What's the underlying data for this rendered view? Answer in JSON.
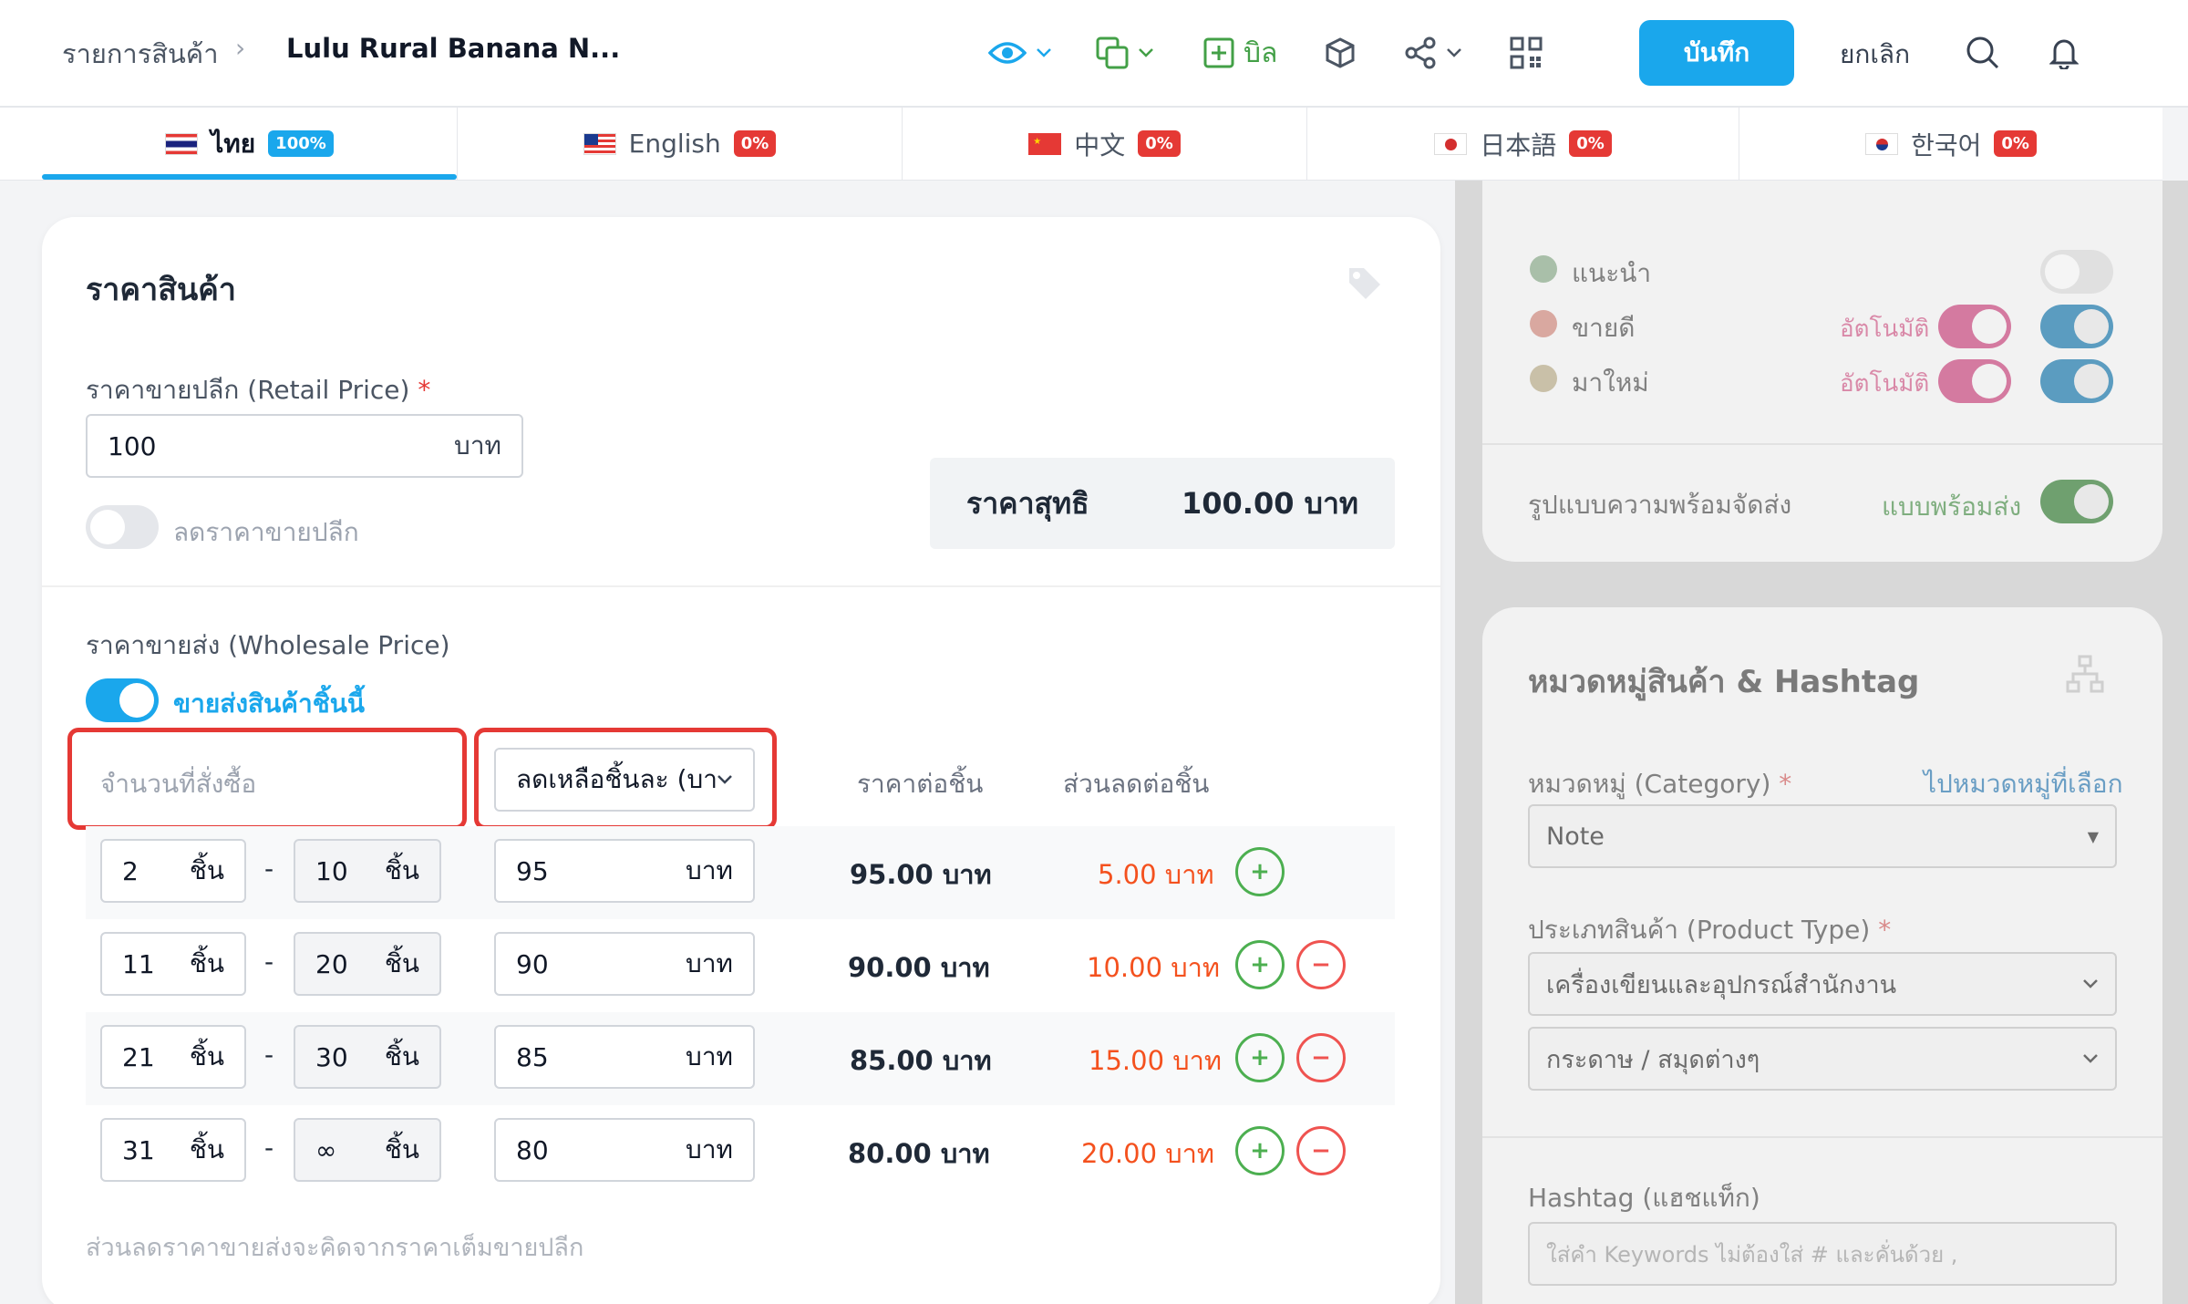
{
  "header": {
    "breadcrumb_parent": "รายการสินค้า",
    "breadcrumb_current": "Lulu Rural Banana N...",
    "bill_label": "บิล",
    "save_label": "บันทึก",
    "cancel_label": "ยกเลิก"
  },
  "languages": [
    {
      "name": "ไทย",
      "percent": "100%",
      "active": true
    },
    {
      "name": "English",
      "percent": "0%"
    },
    {
      "name": "中文",
      "percent": "0%"
    },
    {
      "name": "日本語",
      "percent": "0%"
    },
    {
      "name": "한국어",
      "percent": "0%"
    }
  ],
  "price": {
    "title": "ราคาสินค้า",
    "retail_label": "ราคาขายปลีก (Retail Price)",
    "required_mark": "*",
    "retail_value": "100",
    "unit": "บาท",
    "discount_toggle_label": "ลดราคาขายปลีก",
    "net_label": "ราคาสุทธิ",
    "net_value": "100.00 บาท"
  },
  "wholesale": {
    "label": "ราคาขายส่ง (Wholesale Price)",
    "toggle_label": "ขายส่งสินค้าชิ้นนี้",
    "qty_header": "จำนวนที่สั่งซื้อ",
    "mode_select": "ลดเหลือชิ้นละ (บาท",
    "price_header": "ราคาต่อชิ้น",
    "discount_header": "ส่วนลดต่อชิ้น",
    "piece_unit": "ชิ้น",
    "dash": "-",
    "plus": "+",
    "minus": "−",
    "rows": [
      {
        "from": "2",
        "to": "10",
        "price": "95",
        "per_piece": "95.00 บาท",
        "discount": "5.00 บาท"
      },
      {
        "from": "11",
        "to": "20",
        "price": "90",
        "per_piece": "90.00 บาท",
        "discount": "10.00 บาท"
      },
      {
        "from": "21",
        "to": "30",
        "price": "85",
        "per_piece": "85.00 บาท",
        "discount": "15.00 บาท"
      },
      {
        "from": "31",
        "to": "∞",
        "price": "80",
        "per_piece": "80.00 บาท",
        "discount": "20.00 บาท"
      }
    ],
    "note": "ส่วนลดราคาขายส่งจะคิดจากราคาเต็มขายปลีก"
  },
  "side": {
    "recommend": "แนะนำ",
    "bestseller": "ขายดี",
    "new": "มาใหม่",
    "auto": "อัตโนมัติ",
    "shipping_label": "รูปแบบความพร้อมจัดส่ง",
    "shipping_value": "แบบพร้อมส่ง",
    "category_title": "หมวดหมู่สินค้า & Hashtag",
    "category_label": "หมวดหมู่ (Category)",
    "category_link": "ไปหมวดหมู่ที่เลือก",
    "category_value": "Note",
    "product_type_label": "ประเภทสินค้า (Product Type)",
    "product_type_1": "เครื่องเขียนและอุปกรณ์สำนักงาน",
    "product_type_2": "กระดาษ / สมุดต่างๆ",
    "hashtag_label": "Hashtag (แฮชแท็ก)",
    "hashtag_placeholder": "ใส่คำ Keywords ไม่ต้องใส่ # และคั่นด้วย ,"
  },
  "colors": {
    "accent": "#1aa7ec",
    "danger": "#e53935",
    "success": "#4caf50",
    "orange": "#f4511e"
  }
}
